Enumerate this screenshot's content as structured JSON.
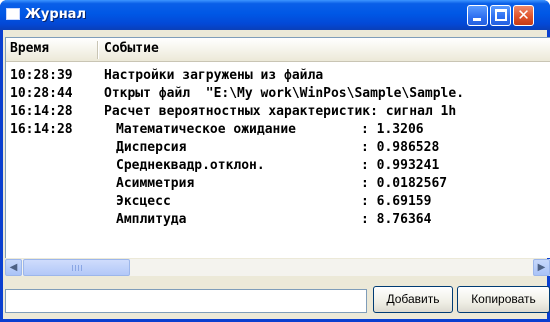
{
  "window": {
    "title": "Журнал"
  },
  "columns": {
    "time": "Время",
    "event": "Событие"
  },
  "log": [
    {
      "time": "10:28:39",
      "event": "Настройки загружены из файла"
    },
    {
      "time": "10:28:44",
      "event": "Открыт файл  \"E:\\My work\\WinPos\\Sample\\Sample."
    },
    {
      "time": "16:14:28",
      "event": "Расчет вероятностных характеристик: сигнал 1h"
    }
  ],
  "stats": {
    "time": "16:14:28",
    "items": [
      {
        "label": "Математическое ожидание",
        "value": ": 1.3206"
      },
      {
        "label": "Дисперсия",
        "value": ": 0.986528"
      },
      {
        "label": "Среднеквадр.отклон.",
        "value": ": 0.993241"
      },
      {
        "label": "Асимметрия",
        "value": ": 0.0182567"
      },
      {
        "label": "Эксцесс",
        "value": ": 6.69159"
      },
      {
        "label": "Амплитуда",
        "value": ": 8.76364"
      }
    ]
  },
  "input": {
    "value": ""
  },
  "buttons": {
    "add": "Добавить",
    "copy": "Копировать"
  },
  "colors": {
    "titlebar": "#0058e6",
    "close_button": "#e0542c",
    "window_face": "#ece9d8"
  }
}
